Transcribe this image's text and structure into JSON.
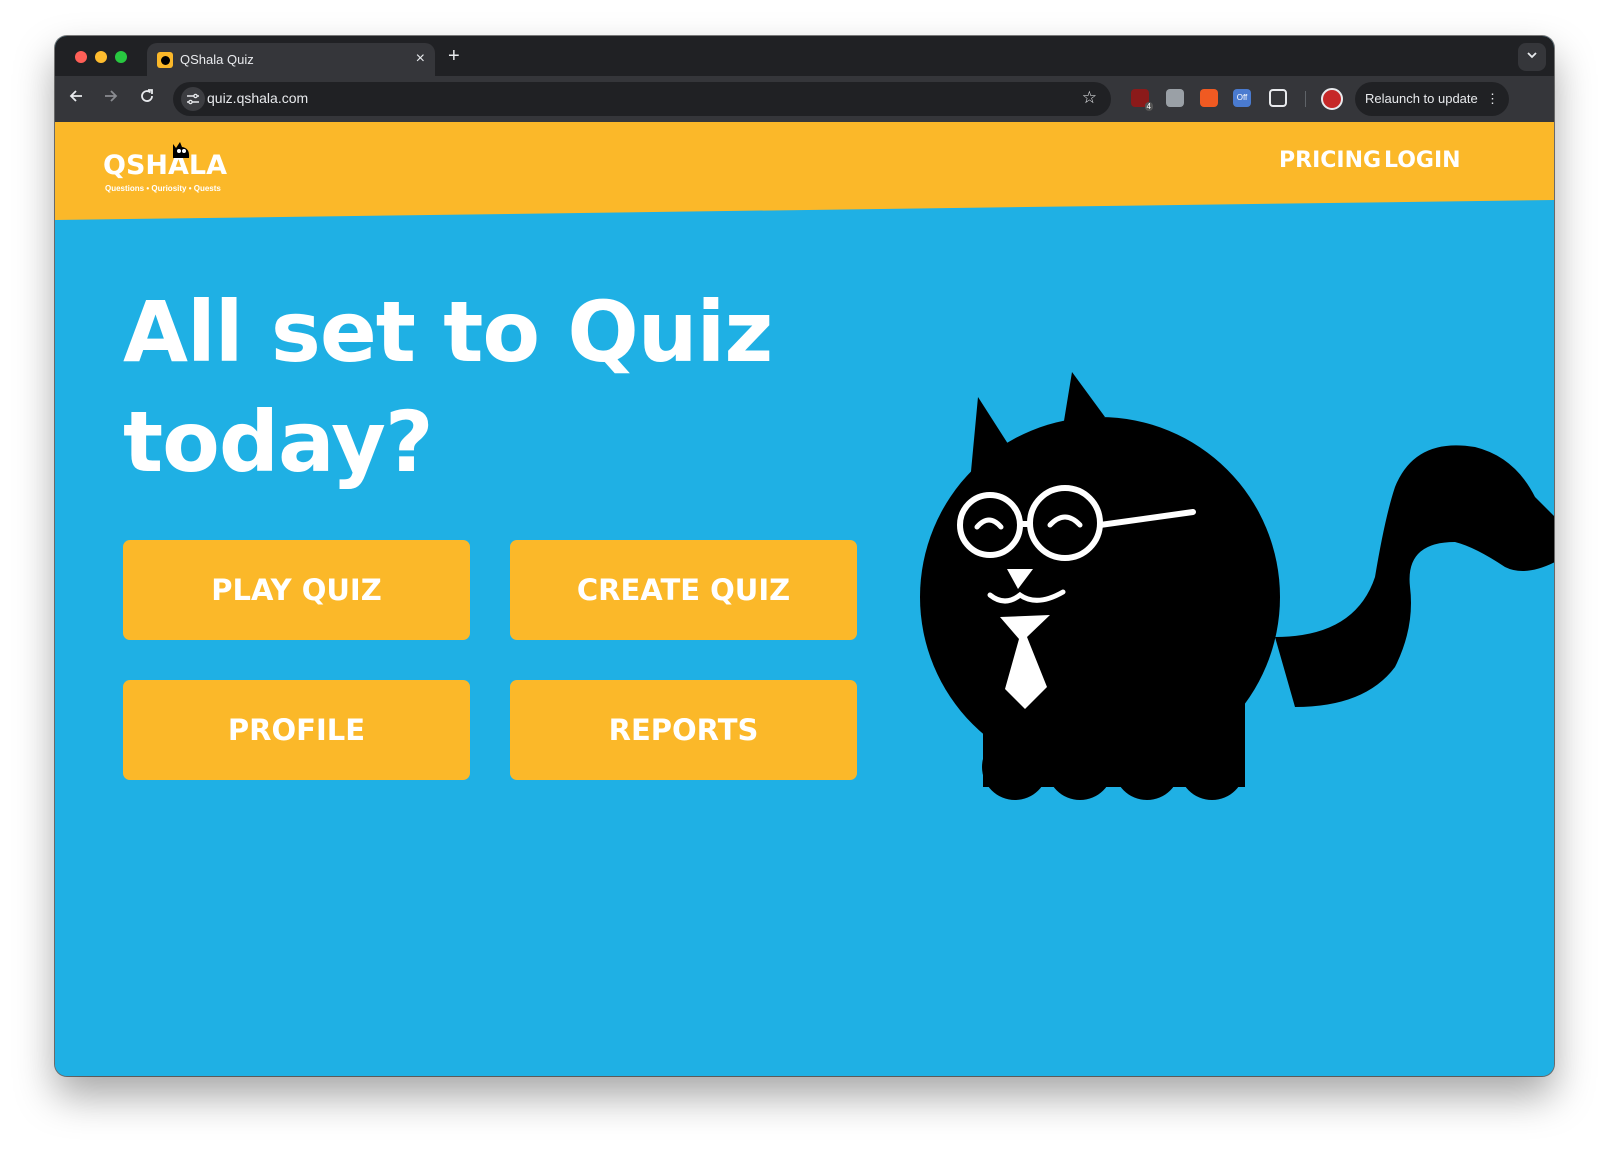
{
  "browser": {
    "tab_title": "QShala Quiz",
    "tab_close": "×",
    "new_tab": "+",
    "url": "quiz.qshala.com",
    "relaunch_label": "Relaunch to update",
    "extension_badge_off": "Off",
    "extension_badge_count": "4"
  },
  "header": {
    "logo_text": "QSHALA",
    "logo_tagline": "Questions • Quriosity • Quests",
    "nav": {
      "pricing": "PRICING",
      "login": "LOGIN"
    }
  },
  "hero": {
    "title": "All set to Quiz today?"
  },
  "actions": {
    "play_quiz": "PLAY QUIZ",
    "create_quiz": "CREATE QUIZ",
    "profile": "PROFILE",
    "reports": "REPORTS"
  },
  "colors": {
    "brand_yellow": "#fbb829",
    "page_blue": "#1fb0e4",
    "cat_black": "#000000"
  }
}
